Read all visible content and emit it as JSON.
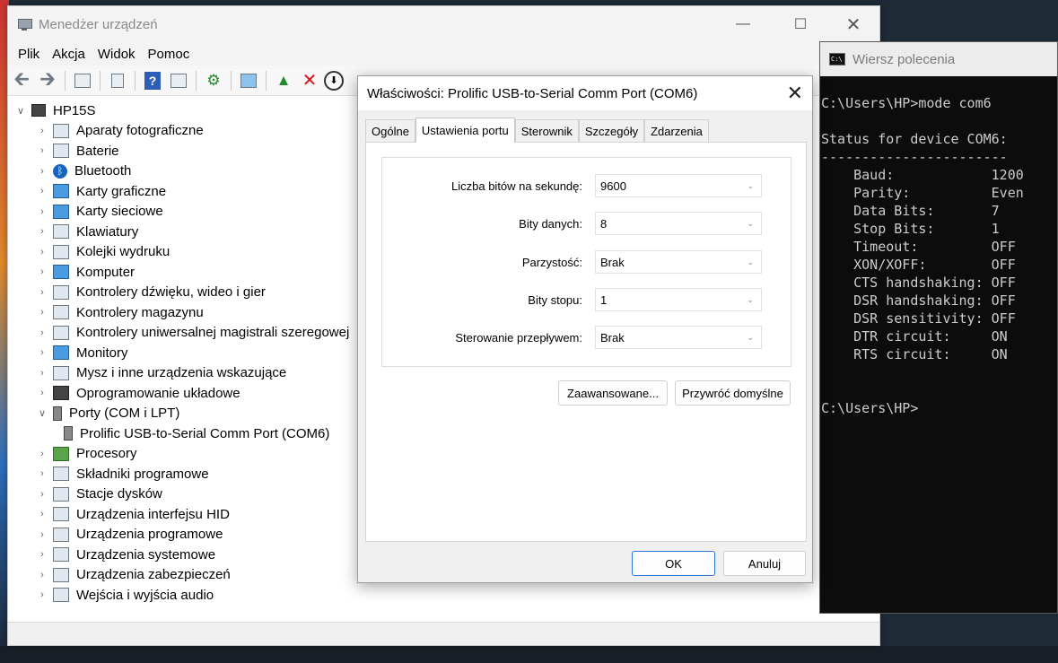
{
  "device_manager": {
    "title": "Menedżer urządzeń",
    "menu": [
      "Plik",
      "Akcja",
      "Widok",
      "Pomoc"
    ],
    "root": "HP15S",
    "categories": [
      {
        "label": "Aparaty fotograficzne",
        "icon": "camera-icon"
      },
      {
        "label": "Baterie",
        "icon": "battery-icon"
      },
      {
        "label": "Bluetooth",
        "icon": "bluetooth-icon"
      },
      {
        "label": "Karty graficzne",
        "icon": "display-adapter-icon"
      },
      {
        "label": "Karty sieciowe",
        "icon": "network-adapter-icon"
      },
      {
        "label": "Klawiatury",
        "icon": "keyboard-icon"
      },
      {
        "label": "Kolejki wydruku",
        "icon": "printer-icon"
      },
      {
        "label": "Komputer",
        "icon": "computer-icon"
      },
      {
        "label": "Kontrolery dźwięku, wideo i gier",
        "icon": "speaker-icon"
      },
      {
        "label": "Kontrolery magazynu",
        "icon": "storage-controller-icon"
      },
      {
        "label": "Kontrolery uniwersalnej magistrali szeregowej",
        "icon": "usb-icon"
      },
      {
        "label": "Monitory",
        "icon": "monitor-icon"
      },
      {
        "label": "Mysz i inne urządzenia wskazujące",
        "icon": "mouse-icon"
      },
      {
        "label": "Oprogramowanie układowe",
        "icon": "firmware-icon"
      },
      {
        "label": "Porty (COM i LPT)",
        "icon": "port-icon"
      },
      {
        "label": "Prolific USB-to-Serial Comm Port (COM6)",
        "icon": "port-icon"
      },
      {
        "label": "Procesory",
        "icon": "processor-icon"
      },
      {
        "label": "Składniki programowe",
        "icon": "software-component-icon"
      },
      {
        "label": "Stacje dysków",
        "icon": "disk-drive-icon"
      },
      {
        "label": "Urządzenia interfejsu HID",
        "icon": "hid-icon"
      },
      {
        "label": "Urządzenia programowe",
        "icon": "software-device-icon"
      },
      {
        "label": "Urządzenia systemowe",
        "icon": "system-device-icon"
      },
      {
        "label": "Urządzenia zabezpieczeń",
        "icon": "security-device-icon"
      },
      {
        "label": "Wejścia i wyjścia audio",
        "icon": "audio-io-icon"
      }
    ]
  },
  "properties_dialog": {
    "title": "Właściwości: Prolific USB-to-Serial Comm Port (COM6)",
    "tabs": [
      "Ogólne",
      "Ustawienia portu",
      "Sterownik",
      "Szczegóły",
      "Zdarzenia"
    ],
    "active_tab": "Ustawienia portu",
    "fields": [
      {
        "label": "Liczba bitów na sekundę:",
        "value": "9600"
      },
      {
        "label": "Bity danych:",
        "value": "8"
      },
      {
        "label": "Parzystość:",
        "value": "Brak"
      },
      {
        "label": "Bity stopu:",
        "value": "1"
      },
      {
        "label": "Sterowanie przepływem:",
        "value": "Brak"
      }
    ],
    "advanced_button": "Zaawansowane...",
    "restore_button": "Przywróć domyślne",
    "ok_button": "OK",
    "cancel_button": "Anuluj"
  },
  "cmd": {
    "title": "Wiersz polecenia",
    "lines": [
      "C:\\Users\\HP>mode com6",
      "",
      "Status for device COM6:",
      "-----------------------",
      "    Baud:            1200",
      "    Parity:          Even",
      "    Data Bits:       7",
      "    Stop Bits:       1",
      "    Timeout:         OFF",
      "    XON/XOFF:        OFF",
      "    CTS handshaking: OFF",
      "    DSR handshaking: OFF",
      "    DSR sensitivity: OFF",
      "    DTR circuit:     ON",
      "    RTS circuit:     ON",
      "",
      "",
      "C:\\Users\\HP>"
    ]
  }
}
